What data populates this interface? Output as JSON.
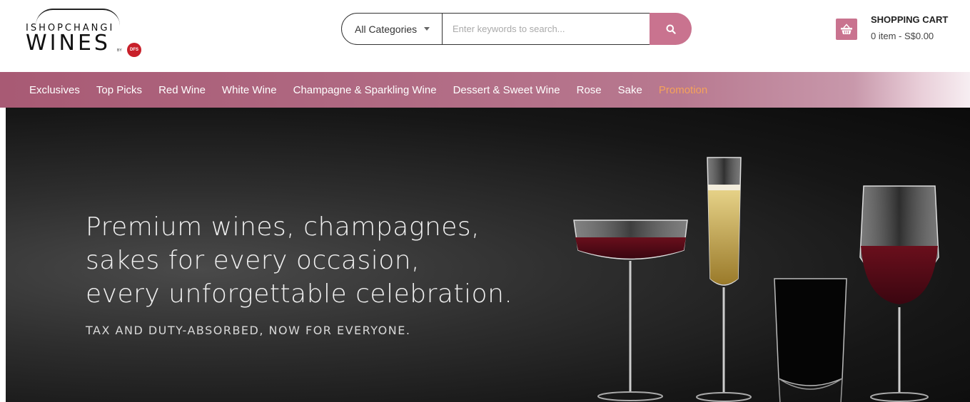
{
  "logo": {
    "top": "ISHOPCHANGI",
    "main": "WINES",
    "by": "BY",
    "badge": "DFS"
  },
  "search": {
    "category": "All Categories",
    "placeholder": "Enter keywords to search..."
  },
  "cart": {
    "title": "SHOPPING CART",
    "summary": "0 item - S$0.00"
  },
  "nav": {
    "items": [
      {
        "label": "Exclusives"
      },
      {
        "label": "Top Picks"
      },
      {
        "label": "Red Wine"
      },
      {
        "label": "White Wine"
      },
      {
        "label": "Champagne & Sparkling Wine"
      },
      {
        "label": "Dessert & Sweet Wine"
      },
      {
        "label": "Rose"
      },
      {
        "label": "Sake"
      },
      {
        "label": "Promotion"
      }
    ]
  },
  "hero": {
    "headline": "Premium wines, champagnes,\nsakes for every occasion,\nevery unforgettable celebration.",
    "subline": "TAX AND DUTY-ABSORBED, NOW FOR EVERYONE."
  },
  "colors": {
    "accent": "#c9738f",
    "nav": "#b06a83",
    "promotion": "#f5a25a"
  },
  "icons": {
    "search": "search-icon",
    "cart": "basket-icon",
    "caret": "chevron-down-icon"
  }
}
